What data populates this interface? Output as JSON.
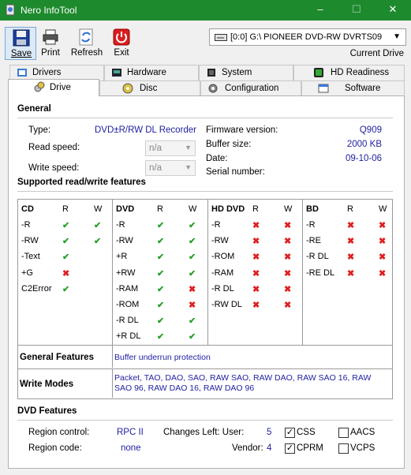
{
  "window": {
    "title": "Nero InfoTool",
    "minimize": "–",
    "maximize": "☐",
    "close": "✕"
  },
  "toolbar": {
    "save": "Save",
    "print": "Print",
    "refresh": "Refresh",
    "exit": "Exit"
  },
  "drive_select": {
    "value": "[0:0]  G:\\ PIONEER  DVD-RW  DVRTS09",
    "caption": "Current Drive"
  },
  "tabs_row1": [
    "Drivers",
    "Hardware",
    "System",
    "HD Readiness"
  ],
  "tabs_row2": [
    "Drive",
    "Disc",
    "Configuration",
    "Software"
  ],
  "general": {
    "heading": "General",
    "type_label": "Type:",
    "type_value": "DVD±R/RW DL Recorder",
    "read_label": "Read speed:",
    "read_value": "n/a",
    "write_label": "Write speed:",
    "write_value": "n/a",
    "fw_label": "Firmware version:",
    "fw_value": "Q909",
    "buf_label": "Buffer size:",
    "buf_value": "2000 KB",
    "date_label": "Date:",
    "date_value": "09-10-06",
    "serial_label": "Serial number:",
    "serial_value": ""
  },
  "features_heading": "Supported read/write features",
  "features": {
    "cd": {
      "title": "CD",
      "r": "R",
      "w": "W",
      "rows": [
        [
          "-R",
          "ok",
          "ok"
        ],
        [
          "-RW",
          "ok",
          "ok"
        ],
        [
          "-Text",
          "ok",
          ""
        ],
        [
          "+G",
          "no",
          ""
        ],
        [
          "C2Error",
          "ok",
          ""
        ]
      ]
    },
    "dvd": {
      "title": "DVD",
      "r": "R",
      "w": "W",
      "rows": [
        [
          "-R",
          "ok",
          "ok"
        ],
        [
          "-RW",
          "ok",
          "ok"
        ],
        [
          "+R",
          "ok",
          "ok"
        ],
        [
          "+RW",
          "ok",
          "ok"
        ],
        [
          "-RAM",
          "ok",
          "no"
        ],
        [
          "-ROM",
          "ok",
          "no"
        ],
        [
          "-R DL",
          "ok",
          "ok"
        ],
        [
          "+R DL",
          "ok",
          "ok"
        ]
      ]
    },
    "hddvd": {
      "title": "HD DVD",
      "r": "R",
      "w": "W",
      "rows": [
        [
          "-R",
          "no",
          "no"
        ],
        [
          "-RW",
          "no",
          "no"
        ],
        [
          "-ROM",
          "no",
          "no"
        ],
        [
          "-RAM",
          "no",
          "no"
        ],
        [
          "-R DL",
          "no",
          "no"
        ],
        [
          "-RW DL",
          "no",
          "no"
        ]
      ]
    },
    "bd": {
      "title": "BD",
      "r": "R",
      "w": "W",
      "rows": [
        [
          "-R",
          "no",
          "no"
        ],
        [
          "-RE",
          "no",
          "no"
        ],
        [
          "-R DL",
          "no",
          "no"
        ],
        [
          "-RE DL",
          "no",
          "no"
        ]
      ]
    }
  },
  "general_features": {
    "label": "General Features",
    "value": "Buffer underrun protection"
  },
  "write_modes": {
    "label": "Write Modes",
    "value": "Packet, TAO, DAO, SAO, RAW SAO, RAW DAO, RAW SAO 16, RAW SAO 96, RAW DAO 16, RAW DAO 96"
  },
  "dvd_features": {
    "heading": "DVD Features",
    "region_control_label": "Region control:",
    "region_control_value": "RPC II",
    "region_code_label": "Region code:",
    "region_code_value": "none",
    "changes_label": "Changes Left: User:",
    "changes_user": "5",
    "vendor_label": "Vendor:",
    "vendor_value": "4",
    "css": "CSS",
    "cprm": "CPRM",
    "aacs": "AACS",
    "vcps": "VCPS",
    "css_checked": true,
    "cprm_checked": true,
    "aacs_checked": false,
    "vcps_checked": false
  },
  "colors": {
    "titlebar": "#1e8a2e",
    "value_text": "#1e1ea0",
    "ok": "#2aa02a",
    "no": "#e02020"
  }
}
